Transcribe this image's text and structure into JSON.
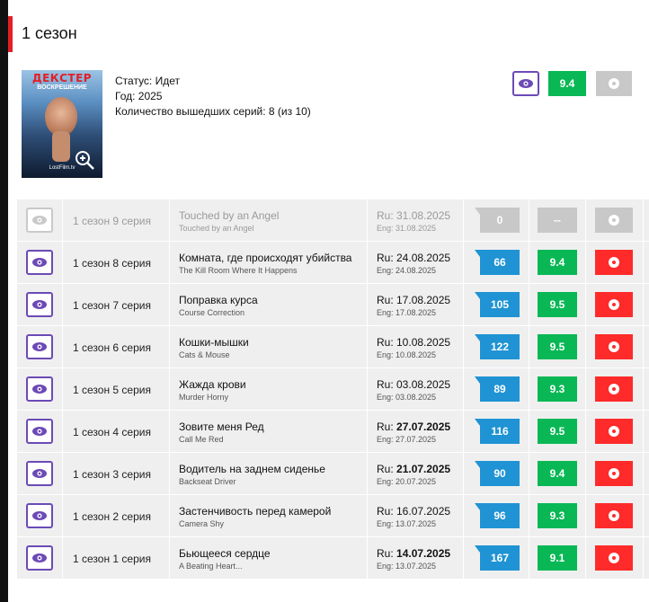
{
  "season": {
    "title": "1 сезон"
  },
  "poster": {
    "title_art": "ДЕКСТЕР",
    "subtitle_art": "ВОСКРЕШЕНИЕ",
    "logo_art": "LostFilm.tv"
  },
  "info": {
    "status": "Статус: Идет",
    "year": "Год: 2025",
    "episodes_out": "Количество вышедших серий: 8 (из 10)"
  },
  "header_actions": {
    "rating": "9.4"
  },
  "colors": {
    "accent_red": "#e21f26",
    "eye_purple": "#6c4ab6",
    "rating_green": "#09b855",
    "comments_blue": "#1f93d3",
    "play_red": "#ff2a2a",
    "disabled_grey": "#c8c8c8"
  },
  "episodes": [
    {
      "label": "1 сезон 9 серия",
      "name_ru": "Touched by an Angel",
      "name_en": "Touched by an Angel",
      "date_ru": "Ru: 31.08.2025",
      "date_en": "Eng: 31.08.2025",
      "comments": "0",
      "rating": "--",
      "state": "upcoming"
    },
    {
      "label": "1 сезон 8 серия",
      "name_ru": "Комната, где происходят убийства",
      "name_en": "The Kill Room Where It Happens",
      "date_ru": "Ru: 24.08.2025",
      "date_en": "Eng: 24.08.2025",
      "comments": "66",
      "rating": "9.4",
      "state": "released"
    },
    {
      "label": "1 сезон 7 серия",
      "name_ru": "Поправка курса",
      "name_en": "Course Correction",
      "date_ru": "Ru: 17.08.2025",
      "date_en": "Eng: 17.08.2025",
      "comments": "105",
      "rating": "9.5",
      "state": "released"
    },
    {
      "label": "1 сезон 6 серия",
      "name_ru": "Кошки-мышки",
      "name_en": "Cats & Mouse",
      "date_ru": "Ru: 10.08.2025",
      "date_en": "Eng: 10.08.2025",
      "comments": "122",
      "rating": "9.5",
      "state": "released"
    },
    {
      "label": "1 сезон 5 серия",
      "name_ru": "Жажда крови",
      "name_en": "Murder Horny",
      "date_ru": "Ru: 03.08.2025",
      "date_en": "Eng: 03.08.2025",
      "comments": "89",
      "rating": "9.3",
      "state": "released"
    },
    {
      "label": "1 сезон 4 серия",
      "name_ru": "Зовите меня Ред",
      "name_en": "Call Me Red",
      "date_ru_prefix": "Ru: ",
      "date_ru_value": "27.07.2025",
      "date_en": "Eng: 27.07.2025",
      "comments": "116",
      "rating": "9.5",
      "state": "released"
    },
    {
      "label": "1 сезон 3 серия",
      "name_ru": "Водитель на заднем сиденье",
      "name_en": "Backseat Driver",
      "date_ru_prefix": "Ru: ",
      "date_ru_value": "21.07.2025",
      "date_en": "Eng: 20.07.2025",
      "comments": "90",
      "rating": "9.4",
      "state": "released"
    },
    {
      "label": "1 сезон 2 серия",
      "name_ru": "Застенчивость перед камерой",
      "name_en": "Camera Shy",
      "date_ru": "Ru: 16.07.2025",
      "date_en": "Eng: 13.07.2025",
      "comments": "96",
      "rating": "9.3",
      "state": "released"
    },
    {
      "label": "1 сезон 1 серия",
      "name_ru": "Бьющееся сердце",
      "name_en": "A Beating Heart...",
      "date_ru_prefix": "Ru: ",
      "date_ru_value": "14.07.2025",
      "date_en": "Eng: 13.07.2025",
      "comments": "167",
      "rating": "9.1",
      "state": "released"
    }
  ]
}
